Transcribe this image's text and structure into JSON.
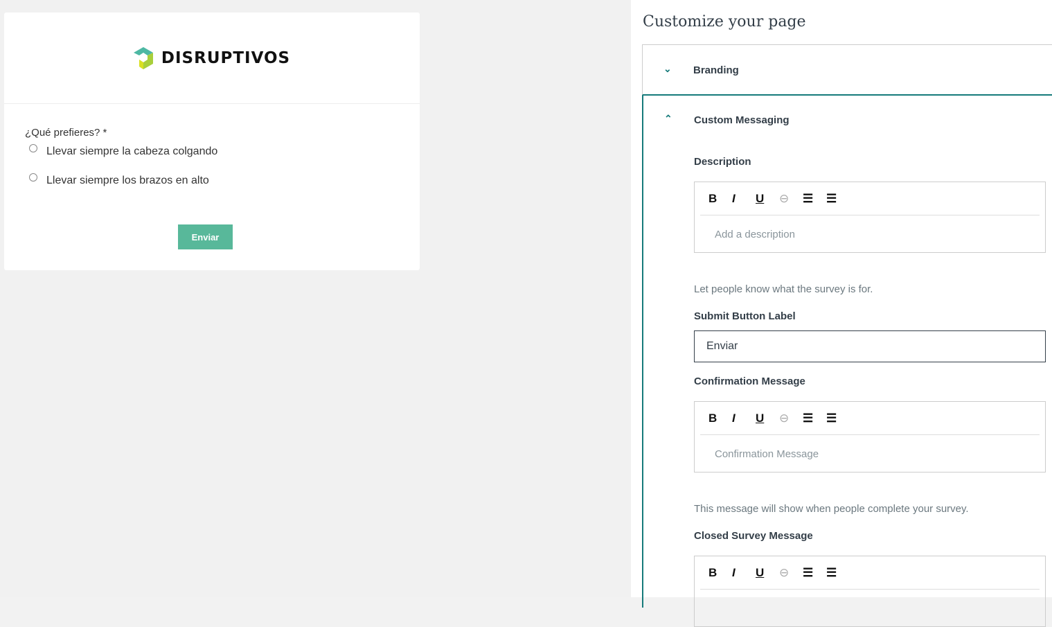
{
  "form": {
    "brand": "DISRUPTIVOS",
    "question": "¿Qué prefieres? *",
    "options": [
      "Llevar siempre la cabeza colgando",
      "Llevar siempre los brazos en alto"
    ],
    "submit_label": "Enviar",
    "accent": "#58b89a"
  },
  "panel": {
    "title": "Customize your page",
    "sections": [
      {
        "label": "Branding",
        "state": "collapsed"
      },
      {
        "label": "Custom Messaging",
        "state": "expanded"
      }
    ],
    "description": {
      "label": "Description",
      "placeholder": "Add a description",
      "help": "Let people know what the survey is for."
    },
    "submit_button": {
      "label": "Submit Button Label",
      "value": "Enviar"
    },
    "confirmation": {
      "label": "Confirmation Message",
      "placeholder": "Confirmation Message",
      "help": "This message will show when people complete your survey."
    },
    "closed": {
      "label": "Closed Survey Message"
    },
    "toolbar": {
      "bold": "B",
      "italic": "I",
      "underline": "U",
      "link": "⊖",
      "bullets": "☰",
      "numbered": "☰"
    },
    "accent": "#157a7a"
  }
}
